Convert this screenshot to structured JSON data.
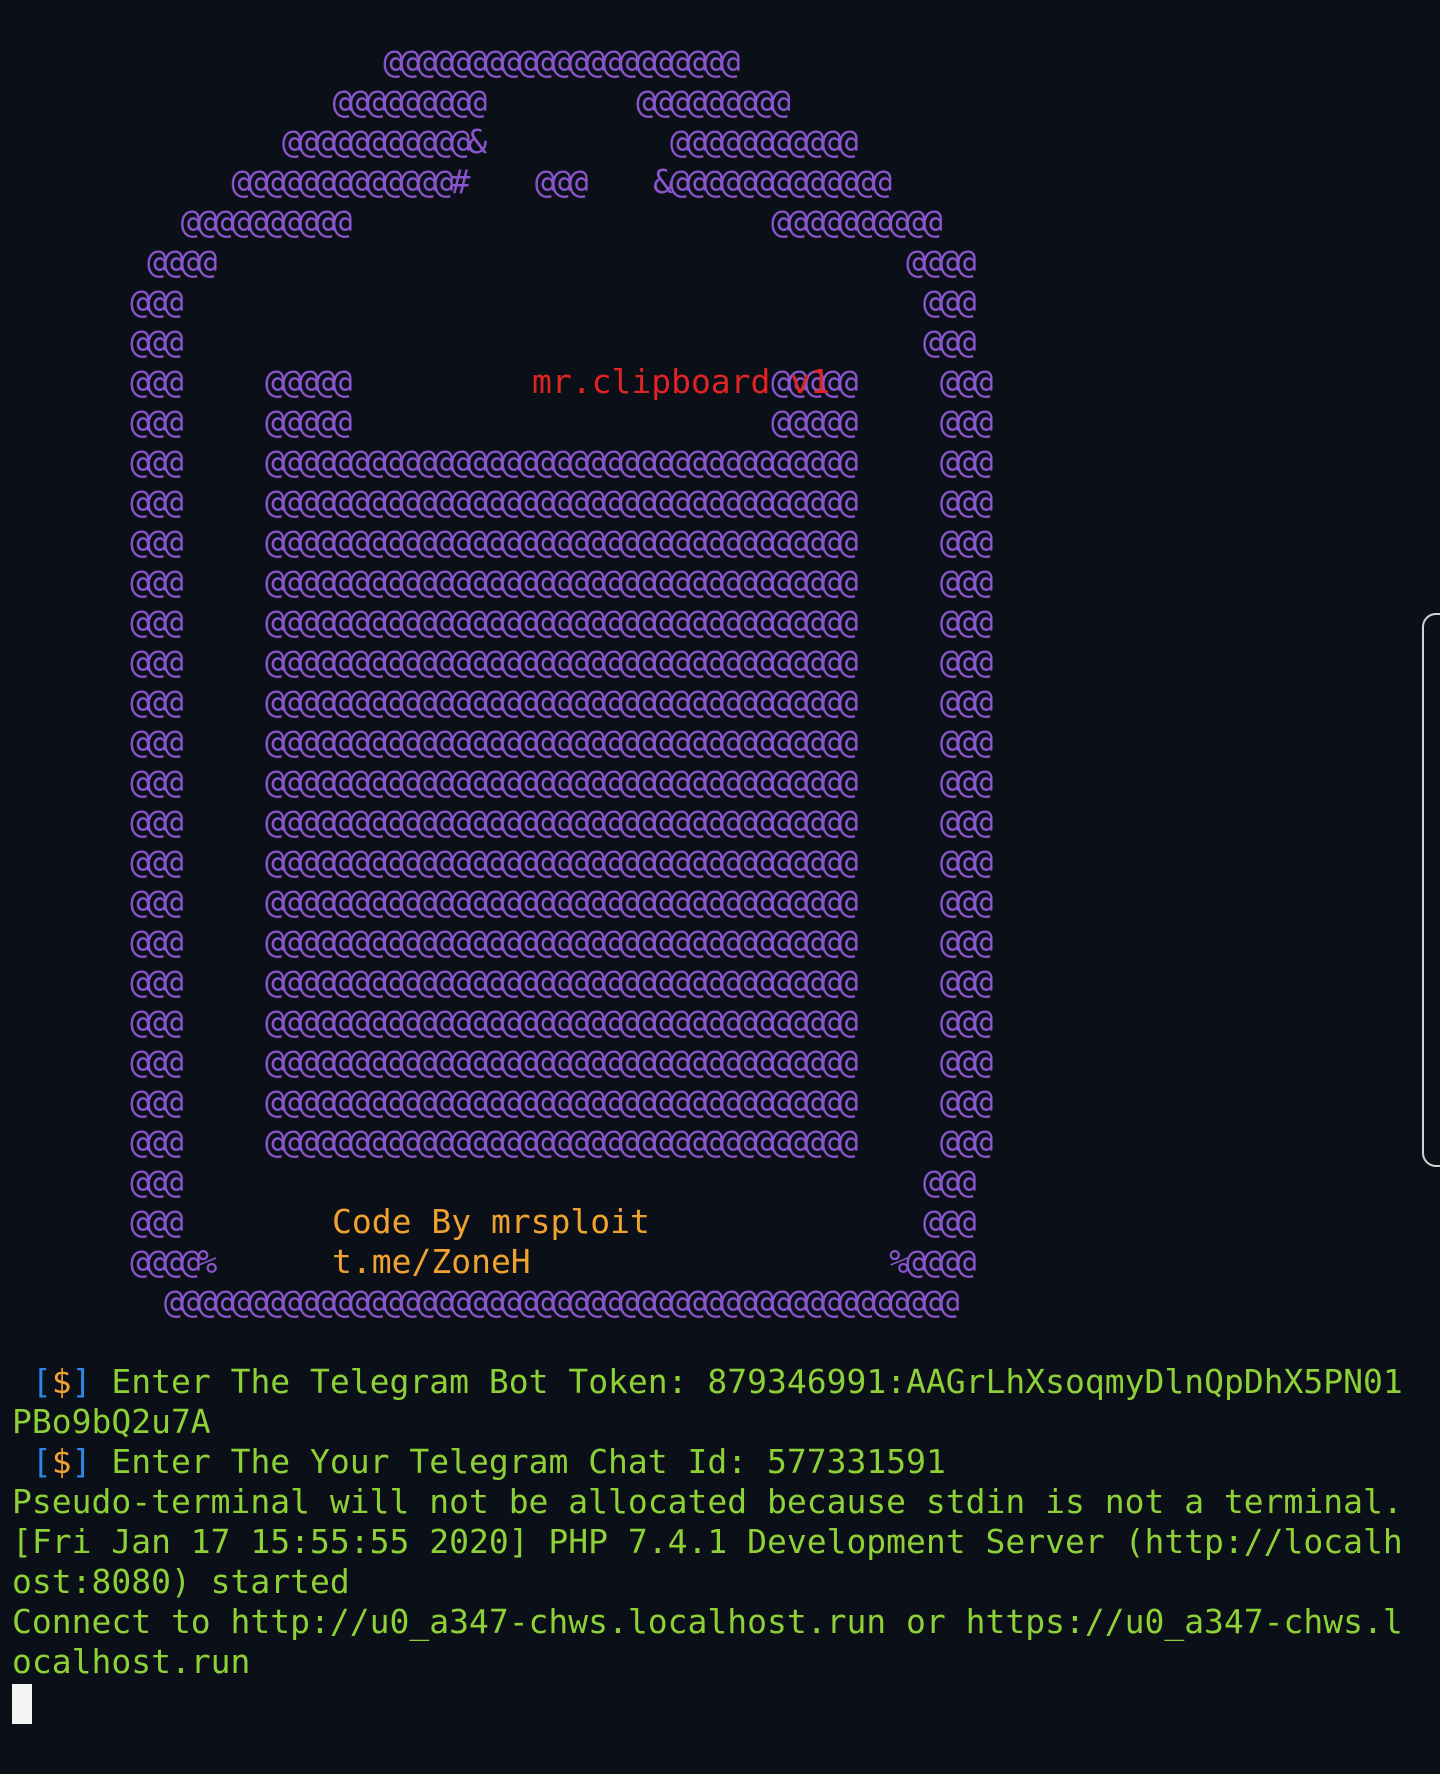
{
  "banner": {
    "lines": [
      "                      @@@@@@@@@@@@@@@@@@@@@",
      "                   @@@@@@@@@         @@@@@@@@@",
      "                @@@@@@@@@@@&           @@@@@@@@@@@",
      "             @@@@@@@@@@@@@#    @@@    &@@@@@@@@@@@@@",
      "          @@@@@@@@@@                         @@@@@@@@@@",
      "        @@@@                                         @@@@",
      "       @@@                                            @@@",
      "       @@@                                            @@@",
      "       @@@     @@@@@                         @@@@@     @@@",
      "       @@@     @@@@@                         @@@@@     @@@",
      "       @@@     @@@@@@@@@@@@@@@@@@@@@@@@@@@@@@@@@@@     @@@",
      "       @@@     @@@@@@@@@@@@@@@@@@@@@@@@@@@@@@@@@@@     @@@",
      "       @@@     @@@@@@@@@@@@@@@@@@@@@@@@@@@@@@@@@@@     @@@",
      "       @@@     @@@@@@@@@@@@@@@@@@@@@@@@@@@@@@@@@@@     @@@",
      "       @@@     @@@@@@@@@@@@@@@@@@@@@@@@@@@@@@@@@@@     @@@",
      "       @@@     @@@@@@@@@@@@@@@@@@@@@@@@@@@@@@@@@@@     @@@",
      "       @@@     @@@@@@@@@@@@@@@@@@@@@@@@@@@@@@@@@@@     @@@",
      "       @@@     @@@@@@@@@@@@@@@@@@@@@@@@@@@@@@@@@@@     @@@",
      "       @@@     @@@@@@@@@@@@@@@@@@@@@@@@@@@@@@@@@@@     @@@",
      "       @@@     @@@@@@@@@@@@@@@@@@@@@@@@@@@@@@@@@@@     @@@",
      "       @@@     @@@@@@@@@@@@@@@@@@@@@@@@@@@@@@@@@@@     @@@",
      "       @@@     @@@@@@@@@@@@@@@@@@@@@@@@@@@@@@@@@@@     @@@",
      "       @@@     @@@@@@@@@@@@@@@@@@@@@@@@@@@@@@@@@@@     @@@",
      "       @@@     @@@@@@@@@@@@@@@@@@@@@@@@@@@@@@@@@@@     @@@",
      "       @@@     @@@@@@@@@@@@@@@@@@@@@@@@@@@@@@@@@@@     @@@",
      "       @@@     @@@@@@@@@@@@@@@@@@@@@@@@@@@@@@@@@@@     @@@",
      "       @@@     @@@@@@@@@@@@@@@@@@@@@@@@@@@@@@@@@@@     @@@",
      "       @@@     @@@@@@@@@@@@@@@@@@@@@@@@@@@@@@@@@@@     @@@",
      "       @@@                                            @@@",
      "       @@@                                            @@@",
      "       @@@@%                                        %@@@@",
      "         @@@@@@@@@@@@@@@@@@@@@@@@@@@@@@@@@@@@@@@@@@@@@@@"
    ],
    "title": "mr.clipboard v1",
    "credit_author": "Code By mrsploit",
    "credit_link": "t.me/ZoneH"
  },
  "prompts": [
    {
      "open": "[",
      "sym": "$",
      "close": "]",
      "text": " Enter The Telegram Bot Token: 879346991:AAGrLhXsoqmyDlnQpDhX5PN01",
      "wrap": "PBo9bQ2u7A"
    },
    {
      "open": "[",
      "sym": "$",
      "close": "]",
      "text": " Enter The Your Telegram Chat Id: 577331591"
    }
  ],
  "output_lines": [
    "Pseudo-terminal will not be allocated because stdin is not a terminal.",
    "[Fri Jan 17 15:55:55 2020] PHP 7.4.1 Development Server (http://localh",
    "ost:8080) started",
    "Connect to http://u0_a347-chws.localhost.run or https://u0_a347-chws.l",
    "ocalhost.run"
  ],
  "colors": {
    "background": "#0b0f17",
    "art": "#8a55cc",
    "title": "#e02424",
    "credit": "#f0a230",
    "output": "#8ed137",
    "bracket": "#2e86e8",
    "cursor": "#f4f4f4"
  }
}
